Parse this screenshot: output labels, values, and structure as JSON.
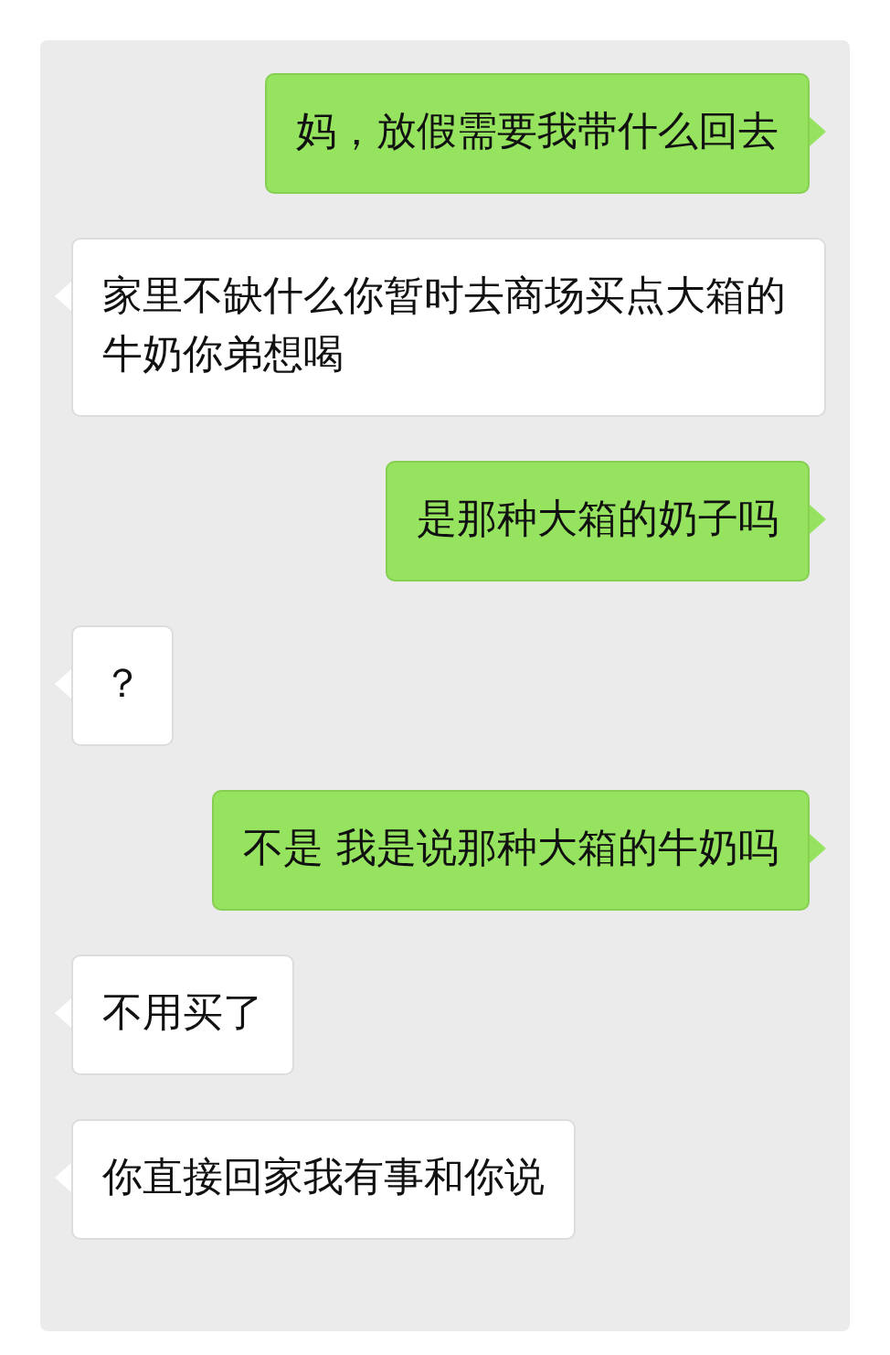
{
  "messages": [
    {
      "kind": "sent",
      "text": "妈，放假需要我带什么回去"
    },
    {
      "kind": "received",
      "text": "家里不缺什么你暂时去商场买点大箱的牛奶你弟想喝"
    },
    {
      "kind": "sent",
      "text": "是那种大箱的奶子吗"
    },
    {
      "kind": "received",
      "text": "？"
    },
    {
      "kind": "sent",
      "text": "不是 我是说那种大箱的牛奶吗"
    },
    {
      "kind": "received",
      "text": "不用买了"
    },
    {
      "kind": "received",
      "text": "你直接回家我有事和你说"
    }
  ]
}
